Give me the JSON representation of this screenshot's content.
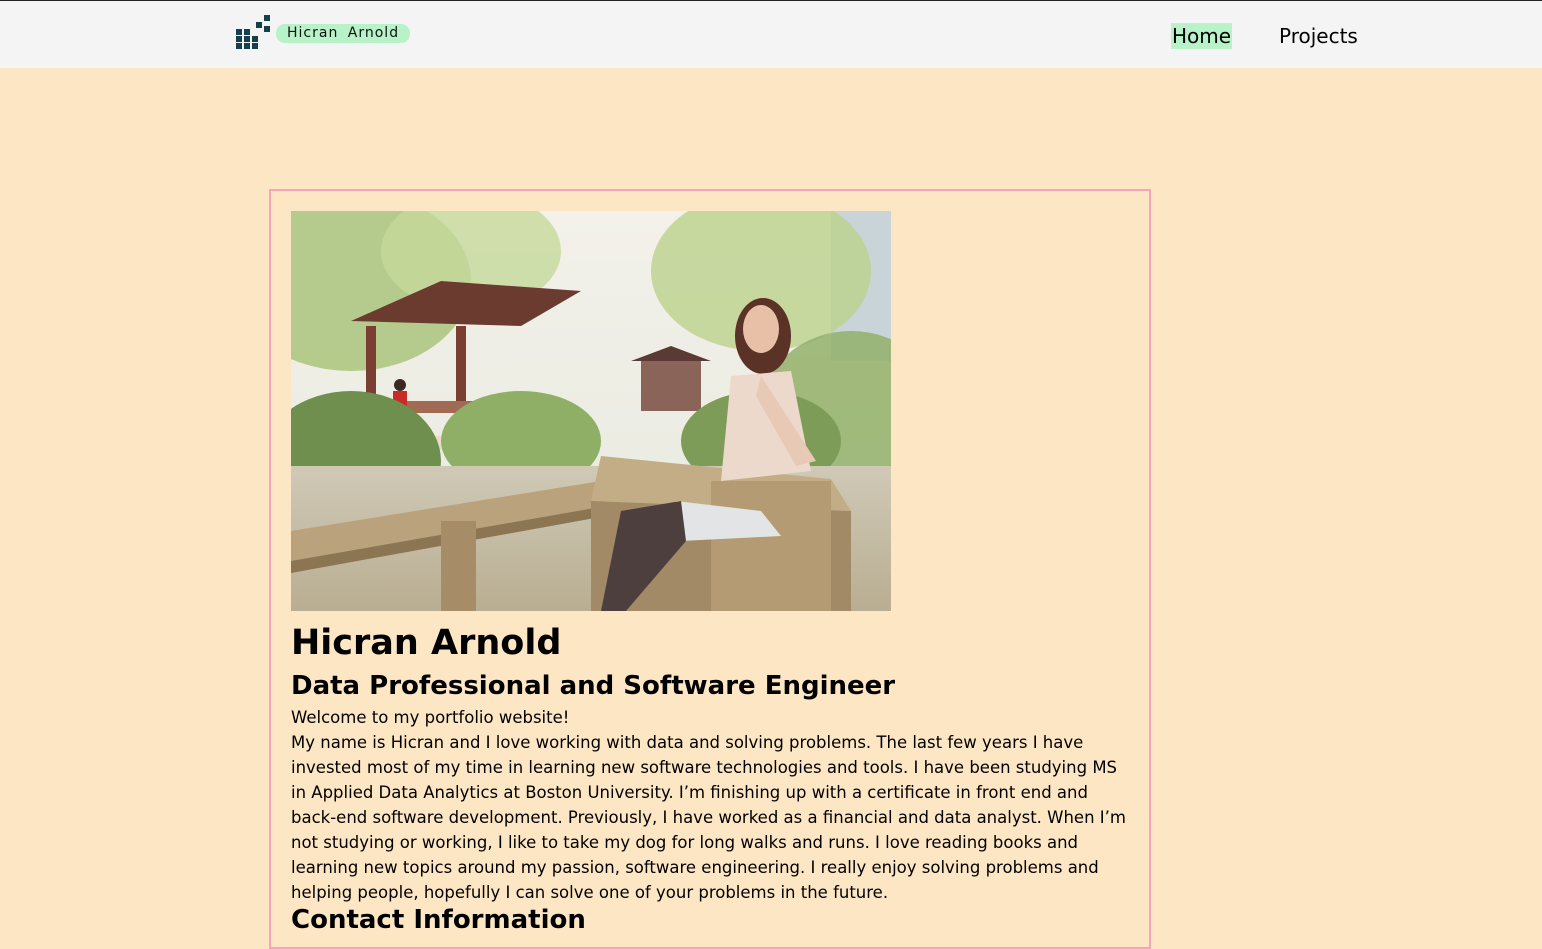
{
  "nav": {
    "brand": "Hicran Arnold",
    "links": [
      {
        "label": "Home",
        "active": true
      },
      {
        "label": "Projects",
        "active": false
      }
    ]
  },
  "profile": {
    "name": "Hicran Arnold",
    "title": "Data Professional and Software Engineer",
    "welcome": "Welcome to my portfolio website!",
    "bio": "My name is Hicran and I love working with data and solving problems. The last few years I have invested most of my time in learning new software technologies and tools. I have been studying MS in Applied Data Analytics at Boston University. I’m finishing up with a certificate in front end and back-end software development. Previously, I have worked as a financial and data analyst. When I’m not studying or working, I like to take my dog for long walks and runs. I love reading books and learning new topics around my passion, software engineering. I really enjoy solving problems and helping people, hopefully I can solve one of your problems in the future.",
    "contact_heading": "Contact Information"
  },
  "colors": {
    "page_bg": "#fde6c4",
    "nav_bg": "#f4f4f4",
    "active_highlight": "#b8f2c8",
    "card_border": "#f4a6b8",
    "logo_dark": "#163f4d"
  },
  "icons": {
    "logo": "pixel-grid-logo-icon"
  }
}
